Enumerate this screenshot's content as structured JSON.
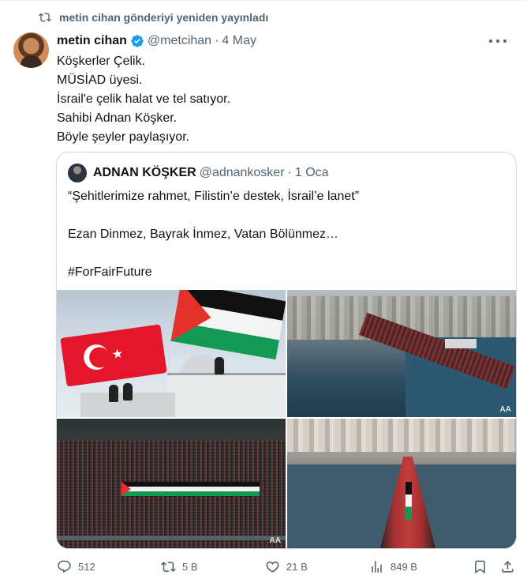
{
  "repost": {
    "label": "metin cihan gönderiyi yeniden yayınladı",
    "icon": "repost-icon"
  },
  "tweet": {
    "author_name": "metin cihan",
    "handle": "@metcihan",
    "separator": "·",
    "date": "4 May",
    "verified": true,
    "verified_color": "#1d9bf0",
    "lines": [
      "Köşkerler Çelik.",
      "MÜSİAD üyesi.",
      "İsrail'e çelik halat ve tel satıyor.",
      "Sahibi Adnan Köşker.",
      "Böyle şeyler paylaşıyor."
    ]
  },
  "quote": {
    "author_name": "ADNAN KÖŞKER",
    "handle": "@adnankosker",
    "separator": "·",
    "date": "1 Oca",
    "lines": [
      "“Şehitlerimize rahmet, Filistin’e destek, İsrail’e lanet”",
      "Ezan Dinmez, Bayrak İnmez, Vatan Bölünmez…",
      "#ForFairFuture"
    ],
    "images": [
      {
        "description_icon": "photo-flags-rooftop"
      },
      {
        "description_icon": "photo-bridge-aerial"
      },
      {
        "description_icon": "photo-crowd-banner"
      },
      {
        "description_icon": "photo-bridge-crowd"
      }
    ],
    "watermark": "AA"
  },
  "actions": {
    "replies": "512",
    "reposts": "5 B",
    "likes": "21 B",
    "views": "849 B"
  },
  "colors": {
    "text": "#0f1419",
    "secondary": "#536471",
    "border": "#cfd9de",
    "accent": "#1d9bf0"
  }
}
